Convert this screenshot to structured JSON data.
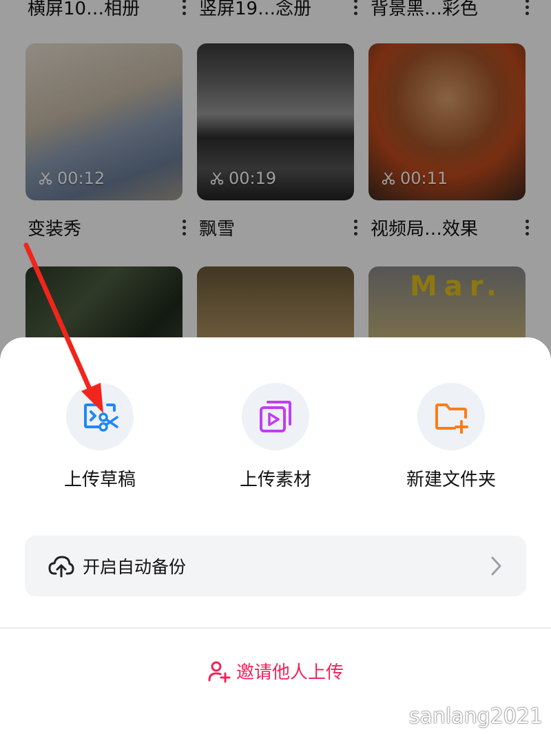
{
  "background_grid": {
    "row0_titles": [
      "横屏10…相册",
      "竖屏19…念册",
      "背景黑…彩色"
    ],
    "row1": [
      {
        "title": "变装秀",
        "duration": "00:12"
      },
      {
        "title": "飘雪",
        "duration": "00:19"
      },
      {
        "title": "视频局…效果",
        "duration": "00:11"
      }
    ],
    "row2_overlay_text": "Mar."
  },
  "sheet": {
    "actions": [
      {
        "label": "上传草稿",
        "icon": "upload-draft-icon",
        "color": "#1e88f5"
      },
      {
        "label": "上传素材",
        "icon": "upload-media-icon",
        "color": "#c23cf0"
      },
      {
        "label": "新建文件夹",
        "icon": "new-folder-icon",
        "color": "#fa7d1a"
      }
    ],
    "backup": {
      "label": "开启自动备份",
      "icon": "cloud-upload-icon"
    },
    "invite": {
      "label": "邀请他人上传",
      "icon": "add-person-icon",
      "color": "#f0245a"
    }
  },
  "watermark": "sanlang2021",
  "annotation_arrow_color": "#f0251c"
}
